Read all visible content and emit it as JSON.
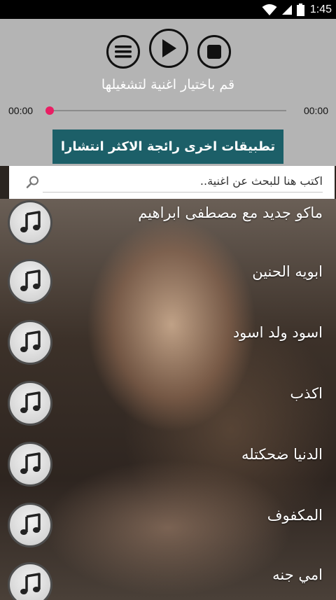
{
  "status_bar": {
    "time": "1:45"
  },
  "player": {
    "now_playing_text": "قم باختيار اغنية لتشغيلها",
    "current_time": "00:00",
    "total_time": "00:00",
    "progress": 0.0,
    "controls": [
      "menu-icon",
      "play-icon",
      "stop-icon"
    ]
  },
  "apps_button_label": "تطبيقات اخرى رائجة الاكثر انتشارا",
  "search": {
    "placeholder": "اكتب هنا للبحث عن اغنية.."
  },
  "songs": [
    {
      "title": "ماكو جديد مع مصطفى ابراهيم"
    },
    {
      "title": "ابويه الحنين"
    },
    {
      "title": "اسود ولد اسود"
    },
    {
      "title": "اكذب"
    },
    {
      "title": "الدنيا ضحكتله"
    },
    {
      "title": "المكفوف"
    },
    {
      "title": "امي جنه"
    }
  ],
  "colors": {
    "accent": "#e91e63",
    "button": "#1c5f68",
    "panel": "#b4b4b4"
  }
}
